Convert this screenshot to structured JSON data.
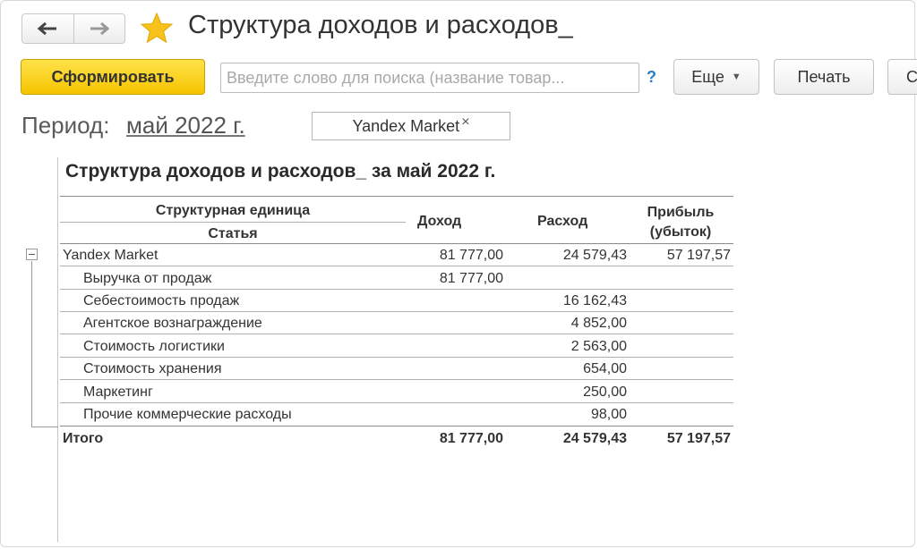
{
  "header": {
    "title": "Структура доходов и расходов_",
    "back_icon": "arrow-left-icon",
    "forward_icon": "arrow-right-icon",
    "favorite_icon": "star-icon",
    "star_color": "#f7c21c"
  },
  "toolbar": {
    "generate_label": "Сформировать",
    "search_placeholder": "Введите слово для поиска (название товар...",
    "help_label": "?",
    "more_label": "Еще",
    "print_label": "Печать",
    "partial_label": "С"
  },
  "period": {
    "label": "Период:",
    "value": "май 2022 г.",
    "filter_value": "Yandex Market",
    "filter_remove": "×"
  },
  "report": {
    "title": "Структура доходов и расходов_ за май 2022 г.",
    "columns": {
      "unit": "Структурная единица",
      "article": "Статья",
      "income": "Доход",
      "expense": "Расход",
      "profit_line1": "Прибыль",
      "profit_line2": "(убыток)"
    },
    "group": {
      "name": "Yandex Market",
      "income": "81 777,00",
      "expense": "24 579,43",
      "profit": "57 197,57"
    },
    "rows": [
      {
        "name": "Выручка от продаж",
        "income": "81 777,00",
        "expense": "",
        "profit": ""
      },
      {
        "name": "Себестоимость продаж",
        "income": "",
        "expense": "16 162,43",
        "profit": ""
      },
      {
        "name": "Агентское вознаграждение",
        "income": "",
        "expense": "4 852,00",
        "profit": ""
      },
      {
        "name": "Стоимость логистики",
        "income": "",
        "expense": "2 563,00",
        "profit": ""
      },
      {
        "name": "Стоимость хранения",
        "income": "",
        "expense": "654,00",
        "profit": ""
      },
      {
        "name": "Маркетинг",
        "income": "",
        "expense": "250,00",
        "profit": ""
      },
      {
        "name": "Прочие коммерческие расходы",
        "income": "",
        "expense": "98,00",
        "profit": ""
      }
    ],
    "total": {
      "name": "Итого",
      "income": "81 777,00",
      "expense": "24 579,43",
      "profit": "57 197,57"
    }
  }
}
